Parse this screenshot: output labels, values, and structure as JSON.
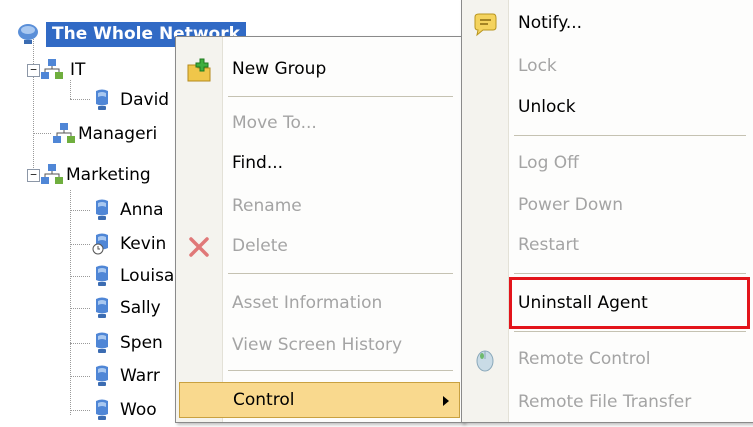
{
  "tree": {
    "root": "The Whole Network",
    "groups": [
      {
        "name": "IT",
        "expander": "−",
        "children": [
          "David"
        ]
      },
      {
        "name": "Manageri",
        "expander": "",
        "children": []
      },
      {
        "name": "Marketing",
        "expander": "−",
        "children": [
          "Anna",
          "Kevin",
          "Louisa",
          "Sally",
          "Spen",
          "Warr",
          "Wood"
        ]
      }
    ],
    "labels": {
      "it": "IT",
      "david": "David",
      "managerial": "Manageri",
      "marketing": "Marketing",
      "anna": "Anna",
      "kevin": "Kevin",
      "louisa": "Louisa",
      "sally": "Sally",
      "spencer": "Spen",
      "warren": "Warr",
      "wood": "Woo"
    }
  },
  "context_menu": {
    "items": [
      {
        "label": "New Group",
        "enabled": true,
        "icon": "new-group-icon"
      },
      {
        "label": "Move To...",
        "enabled": false
      },
      {
        "label": "Find...",
        "enabled": true
      },
      {
        "label": "Rename",
        "enabled": false
      },
      {
        "label": "Delete",
        "enabled": false,
        "icon": "delete-icon"
      },
      {
        "label": "Asset Information",
        "enabled": false
      },
      {
        "label": "View Screen History",
        "enabled": false
      },
      {
        "label": "Control",
        "enabled": true,
        "highlighted": true,
        "has_submenu": true
      }
    ]
  },
  "control_submenu": {
    "items": [
      {
        "label": "Notify...",
        "enabled": true,
        "icon": "notify-icon"
      },
      {
        "label": "Lock",
        "enabled": false
      },
      {
        "label": "Unlock",
        "enabled": true
      },
      {
        "label": "Log Off",
        "enabled": false
      },
      {
        "label": "Power Down",
        "enabled": false
      },
      {
        "label": "Restart",
        "enabled": false
      },
      {
        "label": "Uninstall Agent",
        "enabled": true,
        "annotated": true
      },
      {
        "label": "Remote Control",
        "enabled": false,
        "icon": "remote-control-icon"
      },
      {
        "label": "Remote File Transfer",
        "enabled": false
      }
    ]
  },
  "colors": {
    "selection": "#316ac5",
    "highlight": "#f9d98e",
    "annotation": "#e3141b",
    "disabled_text": "#a4a4a4"
  }
}
